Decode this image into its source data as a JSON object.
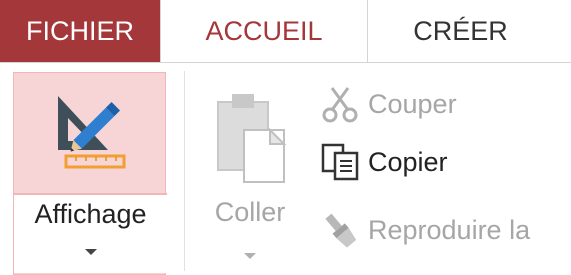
{
  "tabs": {
    "file": "FICHIER",
    "home": "ACCUEIL",
    "create": "CRÉER"
  },
  "ribbon": {
    "view": {
      "label": "Affichage",
      "icon": "design-view-icon",
      "state": "pressed"
    },
    "clipboard": {
      "paste": {
        "label": "Coller",
        "icon": "paste-icon",
        "enabled": false
      },
      "cut": {
        "label": "Couper",
        "icon": "scissors-icon",
        "enabled": false
      },
      "copy": {
        "label": "Copier",
        "icon": "copy-icon",
        "enabled": true
      },
      "format_painter": {
        "label": "Reproduire la",
        "icon": "format-painter-icon",
        "enabled": false
      }
    }
  },
  "colors": {
    "accent": "#a4373a",
    "pressed_fill": "#f7d5d6",
    "disabled_text": "#a6a6a6",
    "window_frame": "#2b8fd6"
  }
}
